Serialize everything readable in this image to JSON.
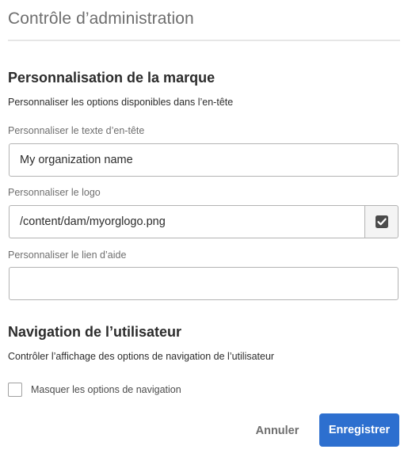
{
  "dialog": {
    "title": "Contrôle d’administration"
  },
  "branding": {
    "heading": "Personnalisation de la marque",
    "description": "Personnaliser les options disponibles dans l’en-tête",
    "header_text": {
      "label": "Personnaliser le texte d’en-tête",
      "value": "My organization name"
    },
    "logo": {
      "label": "Personnaliser le logo",
      "value": "/content/dam/myorglogo.png",
      "picker_icon": "checkbox-picker-icon"
    },
    "help_link": {
      "label": "Personnaliser le lien d’aide",
      "value": ""
    }
  },
  "user_navigation": {
    "heading": "Navigation de l’utilisateur",
    "description": "Contrôler l’affichage des options de navigation de l’utilisateur",
    "hide_nav_checkbox": {
      "label": "Masquer les options de navigation",
      "checked": false
    }
  },
  "footer": {
    "cancel_label": "Annuler",
    "save_label": "Enregistrer"
  },
  "colors": {
    "primary_button": "#2d6fcf",
    "border": "#b3b3b3",
    "muted_text": "#6e6e6e"
  }
}
